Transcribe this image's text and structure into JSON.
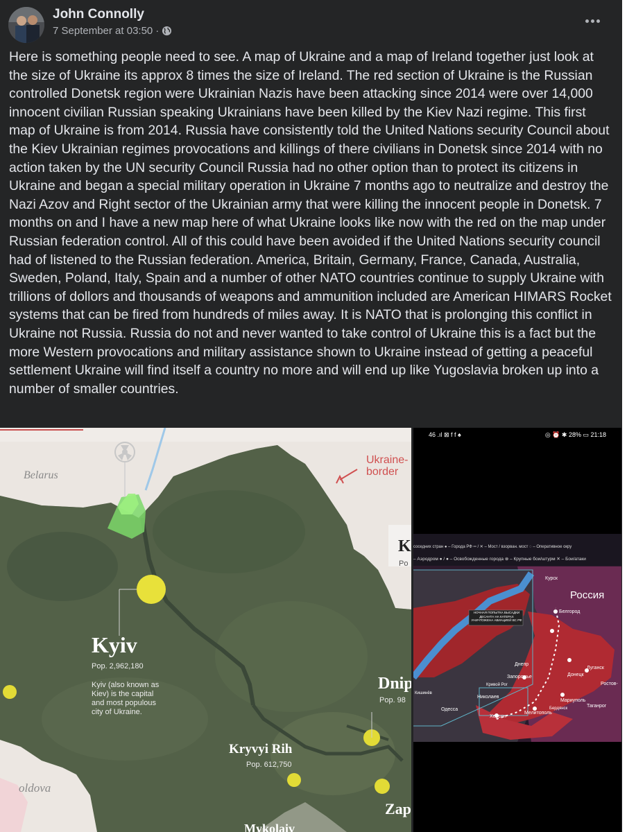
{
  "post": {
    "author": "John Connolly",
    "timestamp": "7 September at 03:50",
    "separator": "·",
    "audience_icon": "globe-icon",
    "more_icon": "more-options-icon",
    "text": "Here is something people need to see. A map of Ukraine and a map of Ireland together just look at the size of Ukraine its approx 8 times the size of Ireland. The red section of Ukraine is the Russian controlled Donetsk region were Ukrainian Nazis have been attacking since 2014 were over 14,000 innocent civilian Russian speaking Ukrainians have been killed by the Kiev Nazi regime. This first map of Ukraine is from 2014. Russia have consistently told the United Nations security Council about the Kiev Ukrainian regimes provocations and killings of there civilians in Donetsk since 2014 with no action taken by the UN security Council Russia had no other option than to protect its citizens in Ukraine and began a special military operation in Ukraine 7 months ago to neutralize and destroy the Nazi Azov and Right sector of the Ukrainian army that were killing the innocent people in Donetsk. 7 months on and I have a new map here of what Ukraine looks like now with the red on the map under Russian federation control. All of this could have been avoided if the United Nations security council had of listened to the Russian federation. America, Britain, Germany, France, Canada, Australia, Sweden, Poland, Italy, Spain and a number of other NATO countries continue to supply Ukraine with trillions of dollors and thousands of weapons and ammunition included are American HIMARS Rocket systems that can be fired from hundreds of miles away. It is NATO that is prolonging this conflict in Ukraine not Russia. Russia do not and never wanted to take control of Ukraine this is a fact but the more Western provocations and military assistance shown to Ukraine instead of getting a peaceful settlement Ukraine will find itself a country no more and will end up like Yugoslavia broken up into a number of smaller countries."
  },
  "map_left": {
    "belarus": "Belarus",
    "border_label_1": "Ukraine-",
    "border_label_2": "border",
    "kyiv": "Kyiv",
    "kyiv_pop": "Pop. 2,962,180",
    "kyiv_note_1": "Kyiv (also known as",
    "kyiv_note_2": "Kiev) is the capital",
    "kyiv_note_3": "and most populous",
    "kyiv_note_4": "city of Ukraine.",
    "dnipro": "Dnip",
    "dnipro_pop": "Pop. 98",
    "k_fragment": "K",
    "k_pop_fragment": "Po",
    "kryvyi": "Kryvyi Rih",
    "kryvyi_pop": "Pop. 612,750",
    "moldova": "oldova",
    "zap": "Zap",
    "mykolaiv": "Mykolaiv"
  },
  "map_right": {
    "status_left": "46 .ıl ⊠ f f ♠",
    "status_right": "◎ ⏰ ✱ 28% ▭ 21:18",
    "legend_1": "соседних стран  ● – Города РФ   ═ / ✕ – Мост / взорван. мост  ◌ – Оперативное окру",
    "legend_2": "– Аэродром  ● / ● – Освобожденные города  ⊗ – Крупные бои/штурм  ✕ – Бои/атаки",
    "russia": "Россия",
    "kursk": "Курск",
    "belgorod": "Белгород",
    "lugansk": "Луганск",
    "rostov": "Ростов-",
    "donetsk": "Донецк",
    "dnepr": "Днепр",
    "zaporozhye": "Запорожье",
    "mariupol": "Мариуполь",
    "taganrog": "Таганрог",
    "melitopol": "Мелитополь",
    "kherson": "Херсон",
    "nikolaev": "Николаев",
    "odessa": "Одесса",
    "berdyansk": "Бердянск",
    "krivoy_rog": "Кривой Рог",
    "kishinev": "Кишинёв",
    "note_line_1": "НОЧНАЯ ПОПЫТКА ВЫСАДКИ",
    "note_line_2": "ДЕСАНТА НА КАТЕРАХ",
    "note_line_3": "УНИЧТОЖЕНА АВИАЦИЕЙ ВС РФ"
  }
}
